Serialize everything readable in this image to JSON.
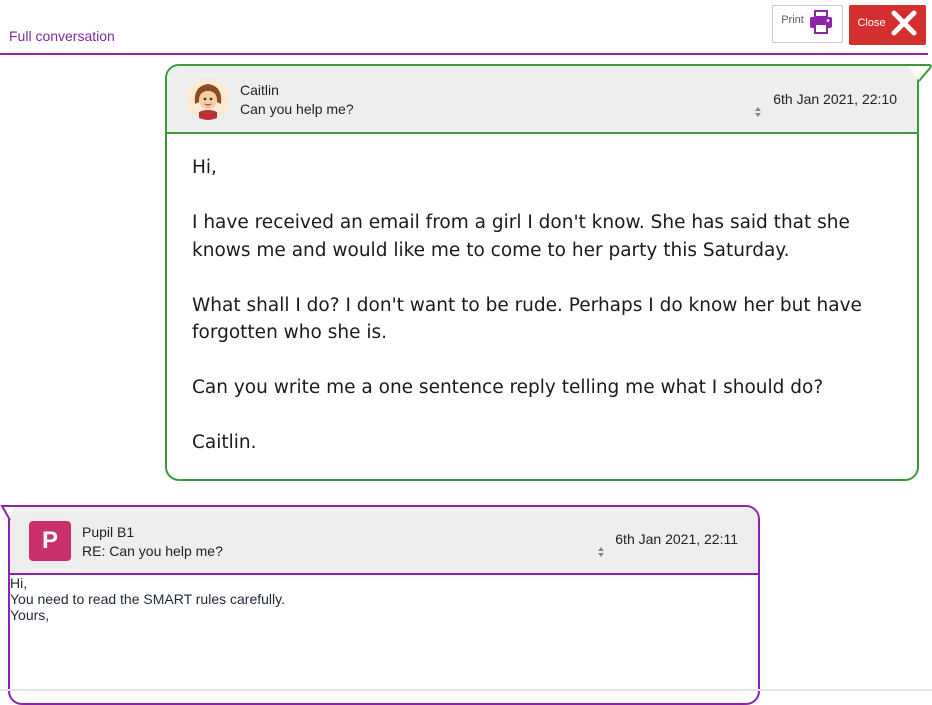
{
  "header": {
    "title": "Full conversation",
    "print_label": "Print",
    "close_label": "Close"
  },
  "messages": [
    {
      "sender": "Caitlin",
      "subject": "Can you help me?",
      "date": "6th Jan 2021, 22:10",
      "avatar": "girl-avatar-icon",
      "border_color": "#3a9a3a",
      "body": [
        "Hi,",
        "I have received an email from a girl I don't know. She has said that she knows me and would like me to come to her party this Saturday.",
        "What shall I do? I don't want to be rude. Perhaps I do know her but have forgotten who she is.",
        "Can you write me a one sentence reply telling me what I should do?",
        "Caitlin."
      ]
    },
    {
      "sender": "Pupil B1",
      "subject": "RE: Can you help me?",
      "date": "6th Jan 2021, 22:11",
      "avatar_letter": "P",
      "avatar_color": "#cc2f6e",
      "border_color": "#8e24aa",
      "body": [
        "Hi,",
        "You need to read the SMART rules carefully.",
        "Yours,"
      ]
    }
  ],
  "colors": {
    "accent_purple": "#8e24aa",
    "close_red": "#d32f2f",
    "print_icon": "#8e24aa"
  }
}
